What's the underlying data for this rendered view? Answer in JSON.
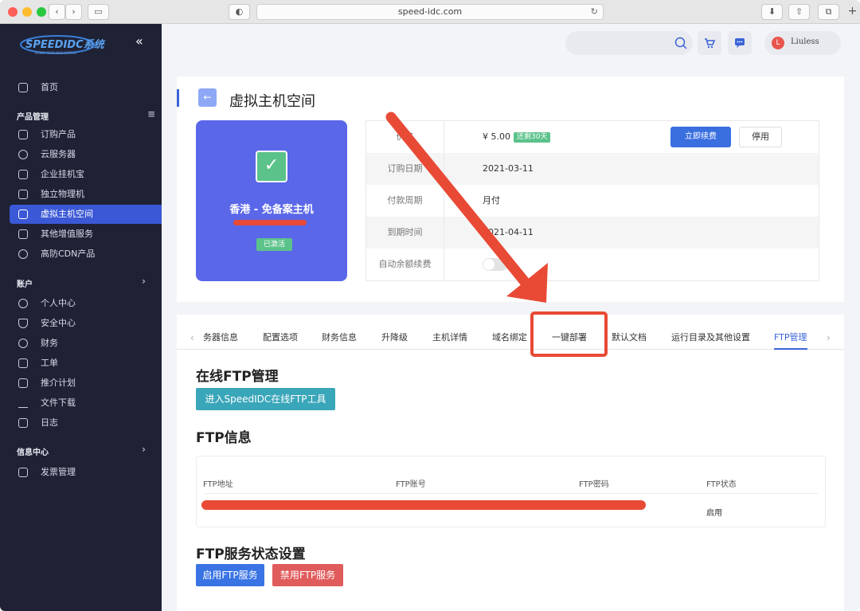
{
  "browser": {
    "url": "speed-idc.com",
    "traffic_lights": [
      "#ff5f57",
      "#febc2e",
      "#28c840"
    ]
  },
  "sidebar": {
    "logo_text": "SPEEDIDC系统",
    "logo_tagline": "BUILD YOUR NEW WORLD",
    "home": "首页",
    "section_products": "产品管理",
    "products": [
      {
        "label": "订购产品",
        "icon": "cart-icon"
      },
      {
        "label": "云服务器",
        "icon": "cloud-icon"
      },
      {
        "label": "企业挂机宝",
        "icon": "monitor-icon"
      },
      {
        "label": "独立物理机",
        "icon": "server-icon"
      },
      {
        "label": "虚拟主机空间",
        "icon": "folder-icon",
        "active": true
      },
      {
        "label": "其他增值服务",
        "icon": "grid-icon"
      },
      {
        "label": "高防CDN产品",
        "icon": "shield-cdn-icon"
      }
    ],
    "section_account": "账户",
    "account": [
      {
        "label": "个人中心",
        "icon": "user-icon"
      },
      {
        "label": "安全中心",
        "icon": "shield-icon"
      },
      {
        "label": "财务",
        "icon": "money-icon"
      },
      {
        "label": "工单",
        "icon": "ticket-icon"
      },
      {
        "label": "推介计划",
        "icon": "referral-icon"
      },
      {
        "label": "文件下载",
        "icon": "download-icon"
      },
      {
        "label": "日志",
        "icon": "log-icon"
      }
    ],
    "section_info": "信息中心",
    "info": [
      {
        "label": "发票管理",
        "icon": "invoice-icon"
      }
    ],
    "accent_color": "#3b58d6"
  },
  "header": {
    "user_initial": "L",
    "user_name": "Liuless"
  },
  "product": {
    "page_title": "虚拟主机空间",
    "name": "香港 - 免备案主机",
    "status_badge": "已激活",
    "fields": [
      {
        "key": "价格",
        "value": "¥ 5.00",
        "tag": "还剩30天"
      },
      {
        "key": "订购日期",
        "value": "2021-03-11"
      },
      {
        "key": "付款周期",
        "value": "月付"
      },
      {
        "key": "到期时间",
        "value": "2021-04-11"
      },
      {
        "key": "自动余额续费",
        "value": ""
      }
    ],
    "renew_button": "立即续费",
    "stop_button": "停用",
    "auto_renew_on": false
  },
  "tabs": {
    "items": [
      "务器信息",
      "配置选项",
      "财务信息",
      "升降级",
      "主机详情",
      "域名绑定",
      "一键部署",
      "默认文档",
      "运行目录及其他设置",
      "FTP管理"
    ],
    "active": "FTP管理"
  },
  "ftp": {
    "online_title": "在线FTP管理",
    "online_button": "进入SpeedIDC在线FTP工具",
    "info_title": "FTP信息",
    "columns": [
      "FTP地址",
      "FTP账号",
      "FTP密码",
      "FTP状态"
    ],
    "status_value": "启用",
    "service_title": "FTP服务状态设置",
    "enable_button": "启用FTP服务",
    "disable_button": "禁用FTP服务"
  },
  "colors": {
    "primary": "#3a63d8",
    "teal": "#3aa6b9",
    "danger": "#e05c5c",
    "annotation": "#e84a35"
  }
}
